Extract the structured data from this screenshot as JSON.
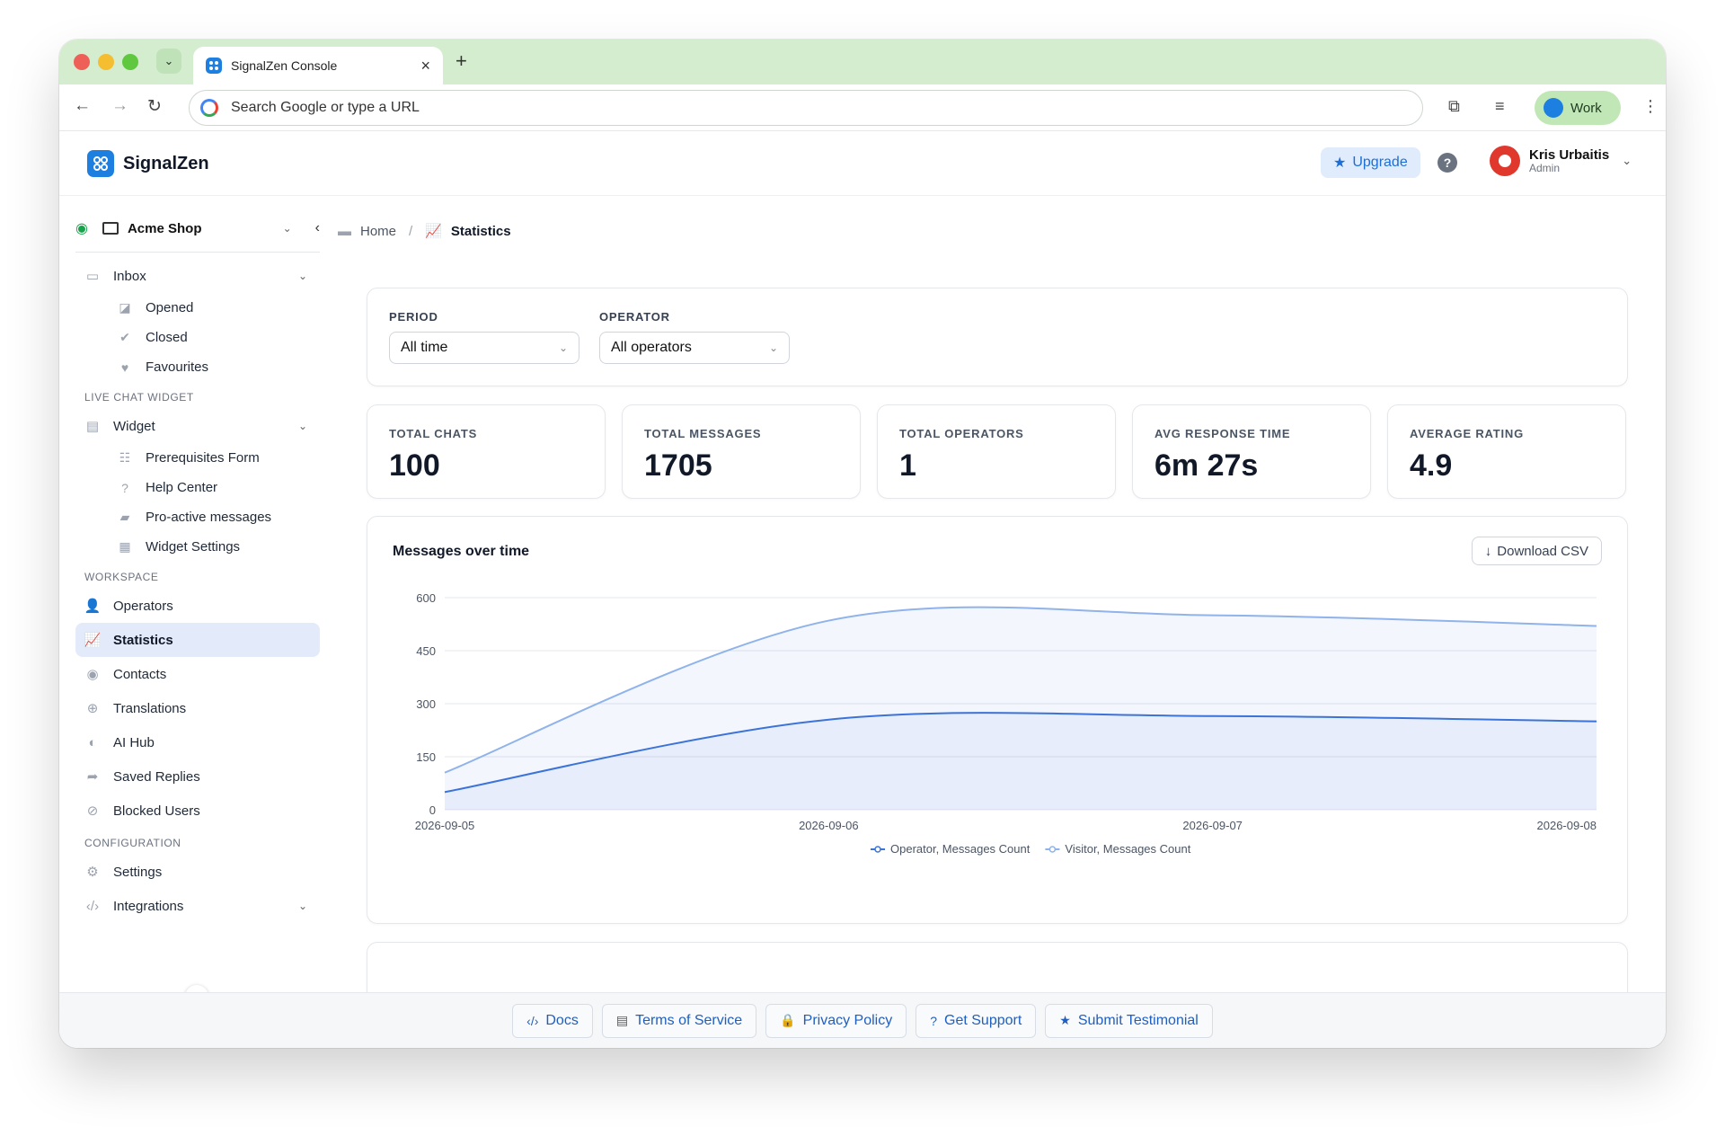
{
  "browser": {
    "tab_title": "SignalZen Console",
    "omnibox_placeholder": "Search Google or type a URL",
    "profile_label": "Work"
  },
  "header": {
    "brand": "SignalZen",
    "upgrade_label": "Upgrade",
    "user_name": "Kris Urbaitis",
    "user_role": "Admin"
  },
  "sidebar": {
    "workspace": "Acme Shop",
    "inbox": {
      "label": "Inbox",
      "items": [
        "Opened",
        "Closed",
        "Favourites"
      ]
    },
    "section_widget": "LIVE CHAT WIDGET",
    "widget": {
      "label": "Widget",
      "items": [
        "Prerequisites Form",
        "Help Center",
        "Pro-active messages",
        "Widget Settings"
      ]
    },
    "section_workspace": "WORKSPACE",
    "workspace_items": [
      "Operators",
      "Statistics",
      "Contacts",
      "Translations",
      "AI Hub",
      "Saved Replies",
      "Blocked Users"
    ],
    "section_config": "CONFIGURATION",
    "config_items": [
      "Settings",
      "Integrations"
    ]
  },
  "breadcrumb": {
    "home": "Home",
    "current": "Statistics"
  },
  "filters": {
    "period_label": "PERIOD",
    "period_value": "All time",
    "operator_label": "OPERATOR",
    "operator_value": "All operators"
  },
  "stats": [
    {
      "label": "TOTAL CHATS",
      "value": "100"
    },
    {
      "label": "TOTAL MESSAGES",
      "value": "1705"
    },
    {
      "label": "TOTAL OPERATORS",
      "value": "1"
    },
    {
      "label": "AVG RESPONSE TIME",
      "value": "6m 27s"
    },
    {
      "label": "AVERAGE RATING",
      "value": "4.9"
    }
  ],
  "chart_panel": {
    "title": "Messages over time",
    "download_label": "Download CSV"
  },
  "chart_data": {
    "type": "area",
    "x": [
      "2026-09-05",
      "2026-09-06",
      "2026-09-07",
      "2026-09-08"
    ],
    "ylim": [
      0,
      600
    ],
    "yticks": [
      0,
      150,
      300,
      450,
      600
    ],
    "grid": true,
    "legend_position": "bottom",
    "series": [
      {
        "name": "Operator, Messages Count",
        "values": [
          50,
          255,
          265,
          250
        ],
        "color": "#3b73d9"
      },
      {
        "name": "Visitor, Messages Count",
        "values": [
          105,
          535,
          550,
          520
        ],
        "color": "#8fb3ea"
      }
    ]
  },
  "footer": {
    "links": [
      "Docs",
      "Terms of Service",
      "Privacy Policy",
      "Get Support",
      "Submit Testimonial"
    ]
  }
}
